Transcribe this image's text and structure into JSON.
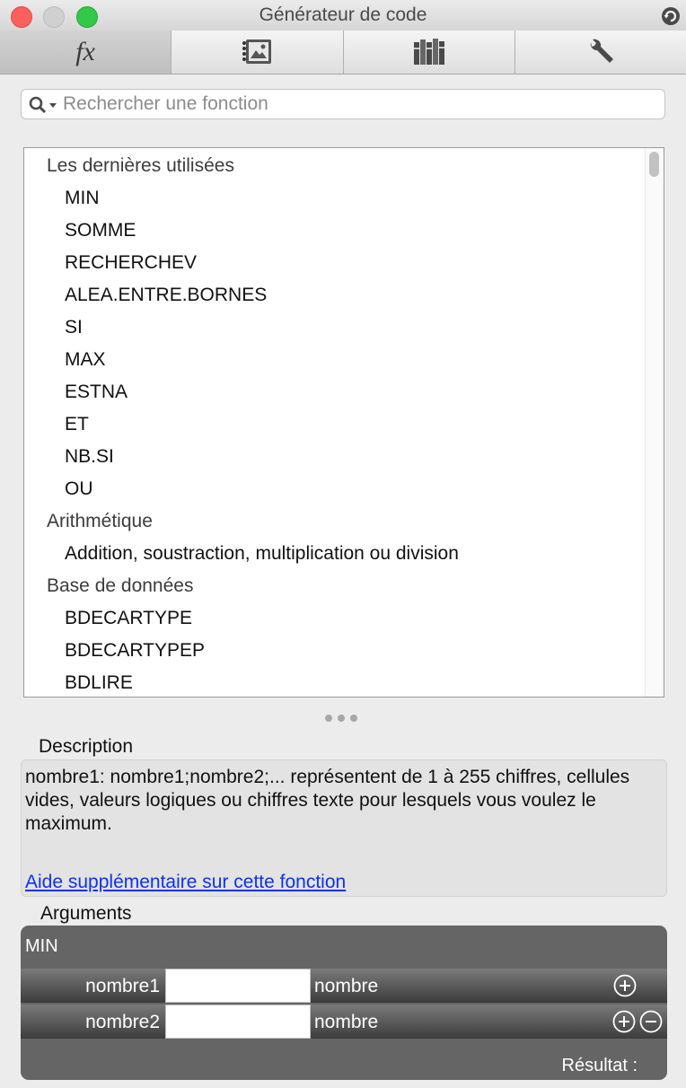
{
  "window": {
    "title": "Générateur de code"
  },
  "search": {
    "placeholder": "Rechercher une fonction"
  },
  "list": {
    "categories": [
      {
        "label": "Les dernières utilisées",
        "items": [
          "MIN",
          "SOMME",
          "RECHERCHEV",
          "ALEA.ENTRE.BORNES",
          "SI",
          "MAX",
          "ESTNA",
          "ET",
          "NB.SI",
          "OU"
        ]
      },
      {
        "label": "Arithmétique",
        "items": [
          "Addition, soustraction, multiplication ou division"
        ]
      },
      {
        "label": "Base de données",
        "items": [
          "BDECARTYPE",
          "BDECARTYPEP",
          "BDLIRE"
        ]
      }
    ]
  },
  "description": {
    "label": "Description",
    "text": "nombre1: nombre1;nombre2;... représentent de 1 à 255 chiffres, cellules vides, valeurs logiques ou chiffres texte pour lesquels vous voulez le maximum.",
    "help_link": "Aide supplémentaire sur cette fonction"
  },
  "arguments": {
    "label": "Arguments",
    "function_name": "MIN",
    "rows": [
      {
        "name": "nombre1",
        "value": "",
        "type": "nombre"
      },
      {
        "name": "nombre2",
        "value": "",
        "type": "nombre"
      }
    ],
    "result_label": "Résultat :"
  },
  "colors": {
    "link": "#0a32f5",
    "close": "#fc605c",
    "zoom": "#34c84a"
  }
}
